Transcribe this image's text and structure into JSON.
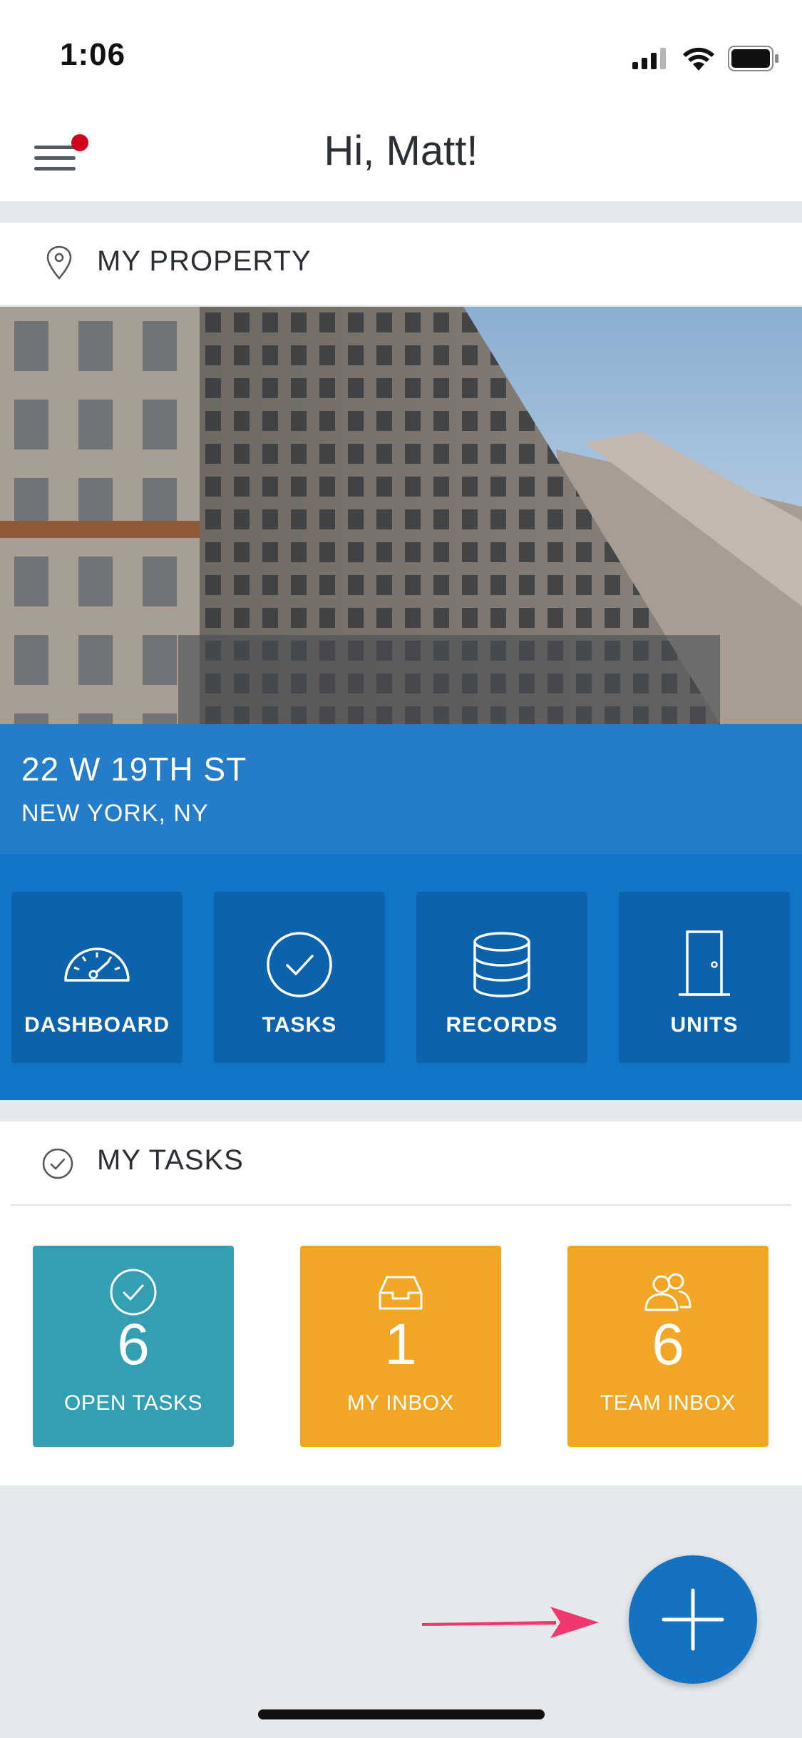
{
  "status_bar": {
    "time": "1:06"
  },
  "header": {
    "greeting": "Hi, Matt!"
  },
  "property": {
    "section_title": "MY PROPERTY",
    "address_line1": "22 W 19TH ST",
    "address_line2": "NEW YORK, NY",
    "nav": [
      {
        "label": "DASHBOARD",
        "icon": "gauge-icon"
      },
      {
        "label": "TASKS",
        "icon": "check-circle-icon"
      },
      {
        "label": "RECORDS",
        "icon": "database-icon"
      },
      {
        "label": "UNITS",
        "icon": "door-icon"
      }
    ]
  },
  "tasks": {
    "section_title": "MY TASKS",
    "tiles": [
      {
        "count": "6",
        "label": "OPEN TASKS",
        "icon": "check-circle-icon",
        "color": "#349fb2"
      },
      {
        "count": "1",
        "label": "MY INBOX",
        "icon": "inbox-icon",
        "color": "#f2a625"
      },
      {
        "count": "6",
        "label": "TEAM INBOX",
        "icon": "users-icon",
        "color": "#f2a625"
      }
    ]
  },
  "colors": {
    "accent": "#1175c7",
    "fab": "#1372c1",
    "notification": "#d0021b",
    "arrow": "#f0376e"
  }
}
